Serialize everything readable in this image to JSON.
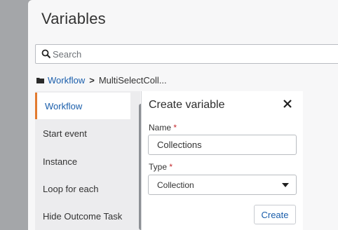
{
  "panel": {
    "title": "Variables",
    "search": {
      "placeholder": "Search",
      "value": ""
    },
    "breadcrumb": {
      "root": "Workflow",
      "current": "MultiSelectColl..."
    }
  },
  "sidebar": {
    "items": [
      {
        "label": "Workflow",
        "active": true
      },
      {
        "label": "Start event",
        "active": false
      },
      {
        "label": "Instance",
        "active": false
      },
      {
        "label": "Loop for each",
        "active": false
      },
      {
        "label": "Hide Outcome Task",
        "active": false
      }
    ]
  },
  "create_variable": {
    "title": "Create variable",
    "name_label": "Name",
    "name_value": "Collections",
    "type_label": "Type",
    "type_value": "Collection",
    "required_mark": "*",
    "create_label": "Create"
  },
  "colors": {
    "link": "#1a5eab",
    "active_indicator": "#e27a2f",
    "required": "#c3272b"
  },
  "icons": {
    "search": "search-icon",
    "folder": "folder-icon",
    "close": "close-icon",
    "dropdown": "caret-down-icon"
  }
}
